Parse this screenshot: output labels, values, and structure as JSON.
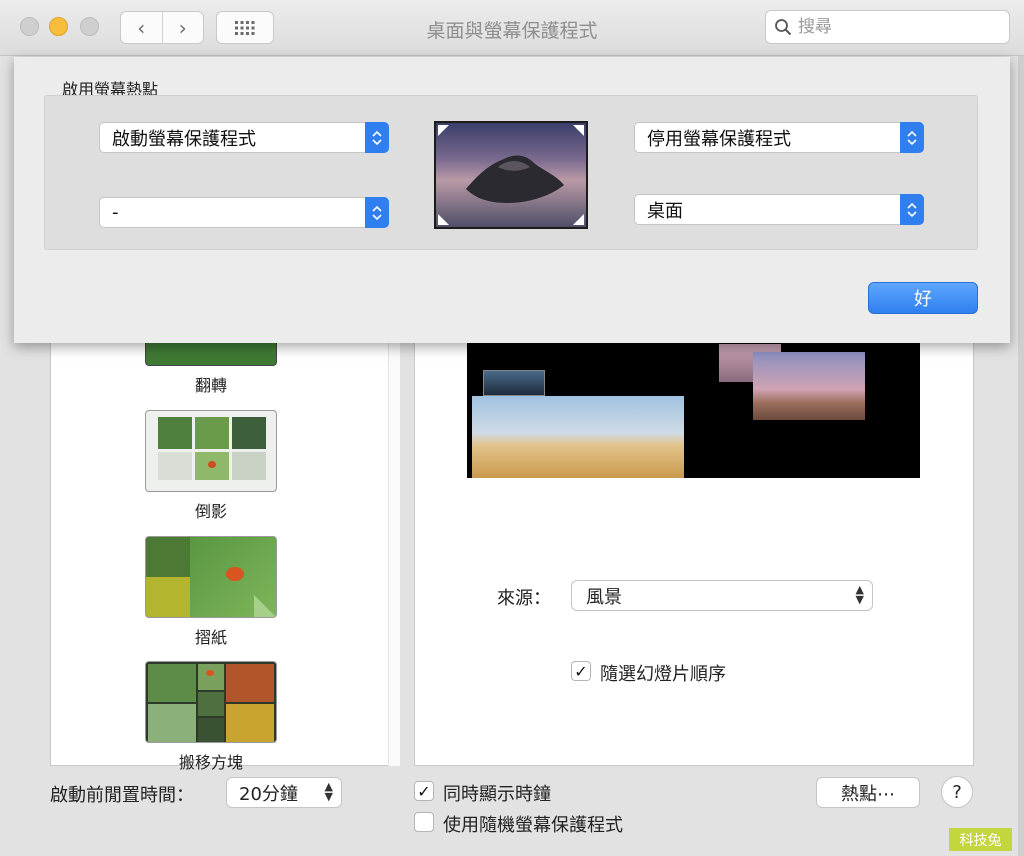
{
  "window": {
    "title": "桌面與螢幕保護程式",
    "nav": {
      "back_icon": "‹",
      "forward_icon": "›"
    },
    "search": {
      "placeholder": "搜尋",
      "value": ""
    }
  },
  "screensaver_list": [
    {
      "label": "翻轉"
    },
    {
      "label": "倒影"
    },
    {
      "label": "摺紙"
    },
    {
      "label": "搬移方塊"
    }
  ],
  "options": {
    "source_label": "來源：",
    "source_value": "風景",
    "shuffle_label": "隨選幻燈片順序",
    "shuffle_checked": true
  },
  "bottom_bar": {
    "idle_label": "啟動前閒置時間：",
    "idle_value": "20分鐘",
    "show_clock_label": "同時顯示時鐘",
    "show_clock_checked": true,
    "random_saver_label": "使用隨機螢幕保護程式",
    "random_saver_checked": false,
    "hot_corners_button": "熱點⋯",
    "help_button": "?"
  },
  "hot_corners_sheet": {
    "title": "啟用螢幕熱點",
    "top_left": "啟動螢幕保護程式",
    "top_right": "停用螢幕保護程式",
    "bottom_left": "-",
    "bottom_right": "桌面",
    "ok_button": "好"
  },
  "watermark": "科技兔",
  "colors": {
    "accent": "#2f7ff0",
    "minimize_light": "#f6be3a",
    "watermark_bg": "#c4d63e"
  }
}
